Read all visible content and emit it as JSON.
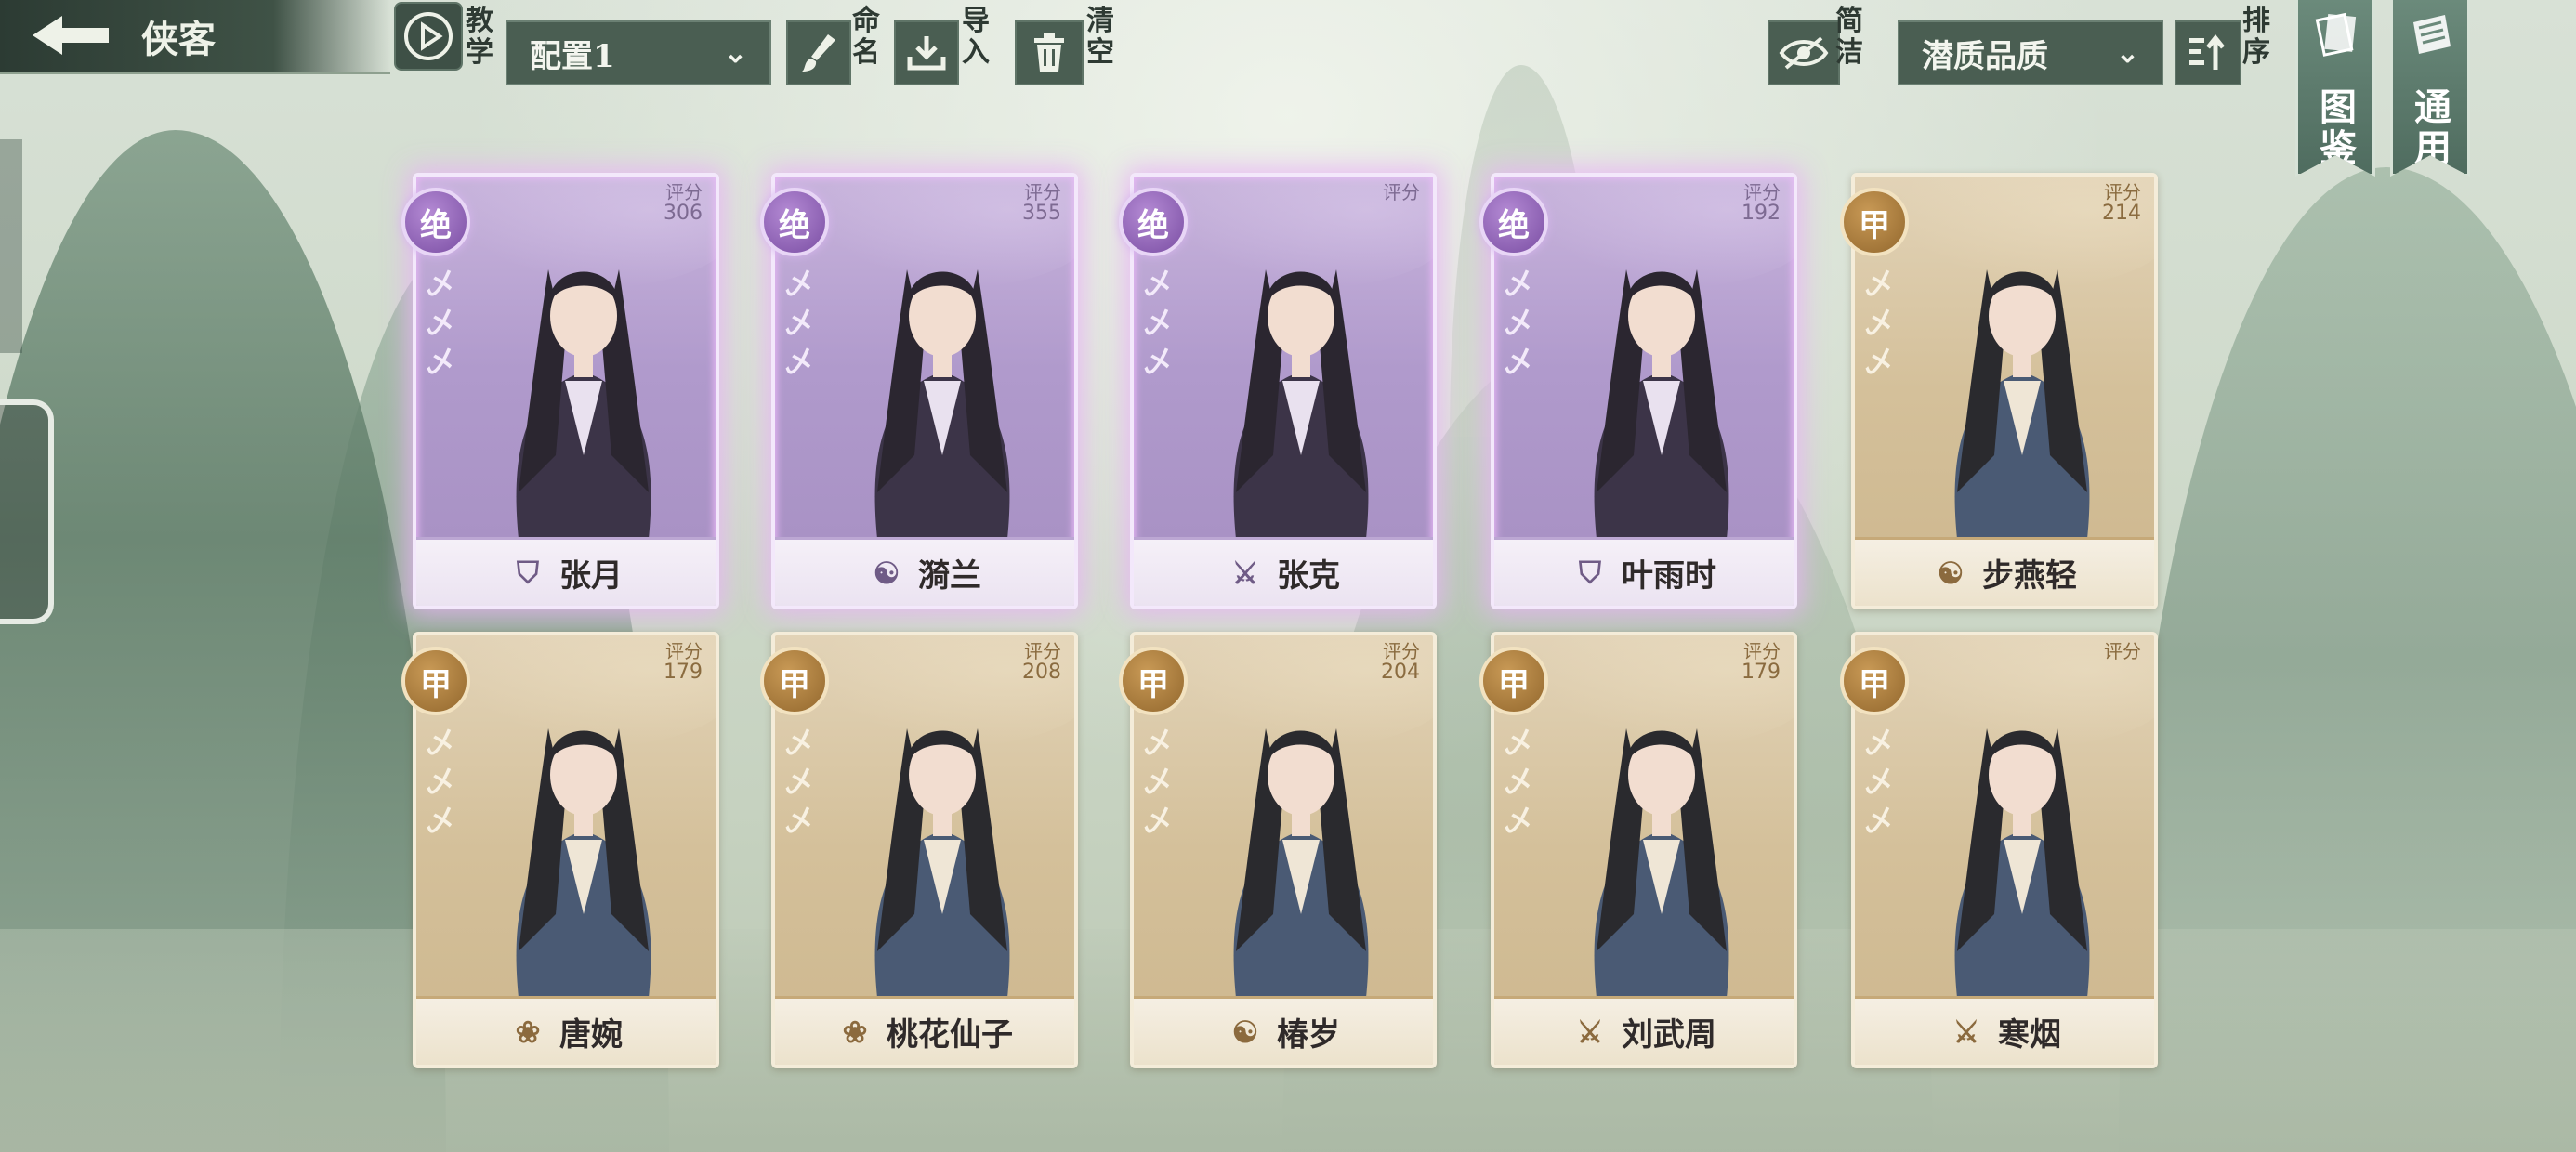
{
  "header": {
    "title": "侠客",
    "back_icon": "back-arrow-icon"
  },
  "toolbar": {
    "tutorial_label": "教学",
    "config_select": "配置1",
    "rename_label": "命名",
    "import_label": "导入",
    "clear_label": "清空",
    "simple_label": "简洁",
    "sort_select": "潜质品质",
    "sort_label": "排序"
  },
  "side_banners": {
    "codex_label": "图鉴",
    "general_label": "通用"
  },
  "score_label": "评分",
  "colors": {
    "jue_accent": "#a68fc2",
    "jia_accent": "#cdb78e",
    "toolbar_bg": "#4a5e52"
  },
  "cards": [
    {
      "name": "张月",
      "grade": "绝",
      "score": "306",
      "class_icon": "shield-icon",
      "stars": [
        "乄",
        "乄",
        "乄"
      ]
    },
    {
      "name": "漪兰",
      "grade": "绝",
      "score": "355",
      "class_icon": "yin-yang-icon",
      "stars": [
        "乄",
        "乄",
        "乄"
      ]
    },
    {
      "name": "张克",
      "grade": "绝",
      "score": "",
      "class_icon": "sword-icon",
      "stars": [
        "乄",
        "乄",
        "乄"
      ]
    },
    {
      "name": "叶雨时",
      "grade": "绝",
      "score": "192",
      "class_icon": "shield-icon",
      "stars": [
        "乄",
        "乄",
        "乄"
      ]
    },
    {
      "name": "步燕轻",
      "grade": "甲",
      "score": "214",
      "class_icon": "yin-yang-icon",
      "stars": [
        "乄",
        "乄",
        "乄"
      ]
    },
    {
      "name": "唐婉",
      "grade": "甲",
      "score": "179",
      "class_icon": "lotus-icon",
      "stars": [
        "乄",
        "乄",
        "乄"
      ]
    },
    {
      "name": "桃花仙子",
      "grade": "甲",
      "score": "208",
      "class_icon": "lotus-icon",
      "stars": [
        "乄",
        "乄",
        "乄"
      ]
    },
    {
      "name": "椿岁",
      "grade": "甲",
      "score": "204",
      "class_icon": "yin-yang-icon",
      "stars": [
        "乄",
        "乄",
        "乄"
      ]
    },
    {
      "name": "刘武周",
      "grade": "甲",
      "score": "179",
      "class_icon": "sword-icon",
      "stars": [
        "乄",
        "乄",
        "乄"
      ]
    },
    {
      "name": "寒烟",
      "grade": "甲",
      "score": "",
      "class_icon": "sword-icon",
      "stars": [
        "乄",
        "乄",
        "乄"
      ]
    }
  ]
}
